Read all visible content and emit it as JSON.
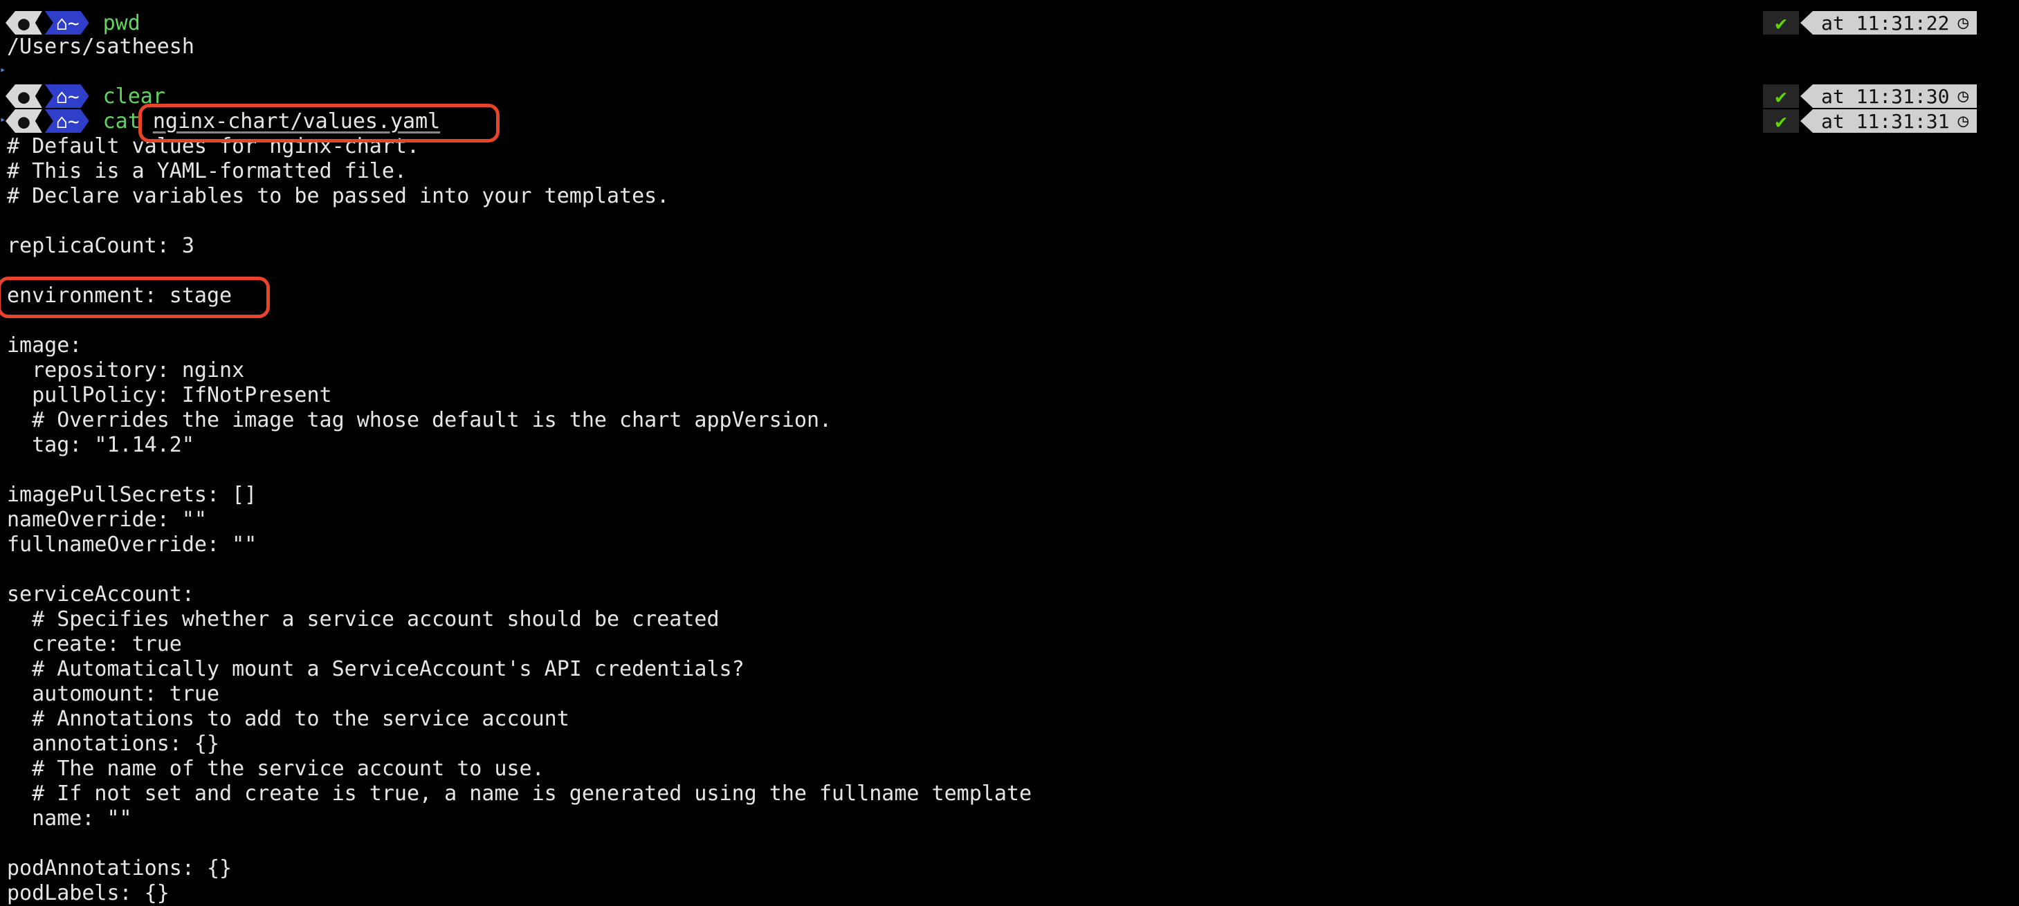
{
  "prompt": {
    "os_icon": "apple-icon",
    "dir_icon": "home-icon",
    "dir": "~"
  },
  "session": [
    {
      "command": "pwd",
      "args": "",
      "time": "at 11:31:22",
      "status_icon": "check-icon"
    },
    {
      "command": "clear",
      "args": "",
      "time": "at 11:31:30",
      "status_icon": "check-icon"
    },
    {
      "command": "cat",
      "args": "nginx-chart/values.yaml",
      "time": "at 11:31:31",
      "status_icon": "check-icon"
    }
  ],
  "pwd_output": "/Users/satheesh",
  "yaml_lines": [
    "# Default values for nginx-chart.",
    "# This is a YAML-formatted file.",
    "# Declare variables to be passed into your templates.",
    "",
    "replicaCount: 3",
    "",
    "environment: stage",
    "",
    "image:",
    "  repository: nginx",
    "  pullPolicy: IfNotPresent",
    "  # Overrides the image tag whose default is the chart appVersion.",
    "  tag: \"1.14.2\"",
    "",
    "imagePullSecrets: []",
    "nameOverride: \"\"",
    "fullnameOverride: \"\"",
    "",
    "serviceAccount:",
    "  # Specifies whether a service account should be created",
    "  create: true",
    "  # Automatically mount a ServiceAccount's API credentials?",
    "  automount: true",
    "  # Annotations to add to the service account",
    "  annotations: {}",
    "  # The name of the service account to use.",
    "  # If not set and create is true, a name is generated using the fullname template",
    "  name: \"\"",
    "",
    "podAnnotations: {}",
    "podLabels: {}"
  ],
  "colors": {
    "background": "#000000",
    "command": "#5fd75f",
    "dir_segment": "#2f3fc9",
    "highlight": "#e8432c",
    "status_ok": "#5fd700"
  }
}
